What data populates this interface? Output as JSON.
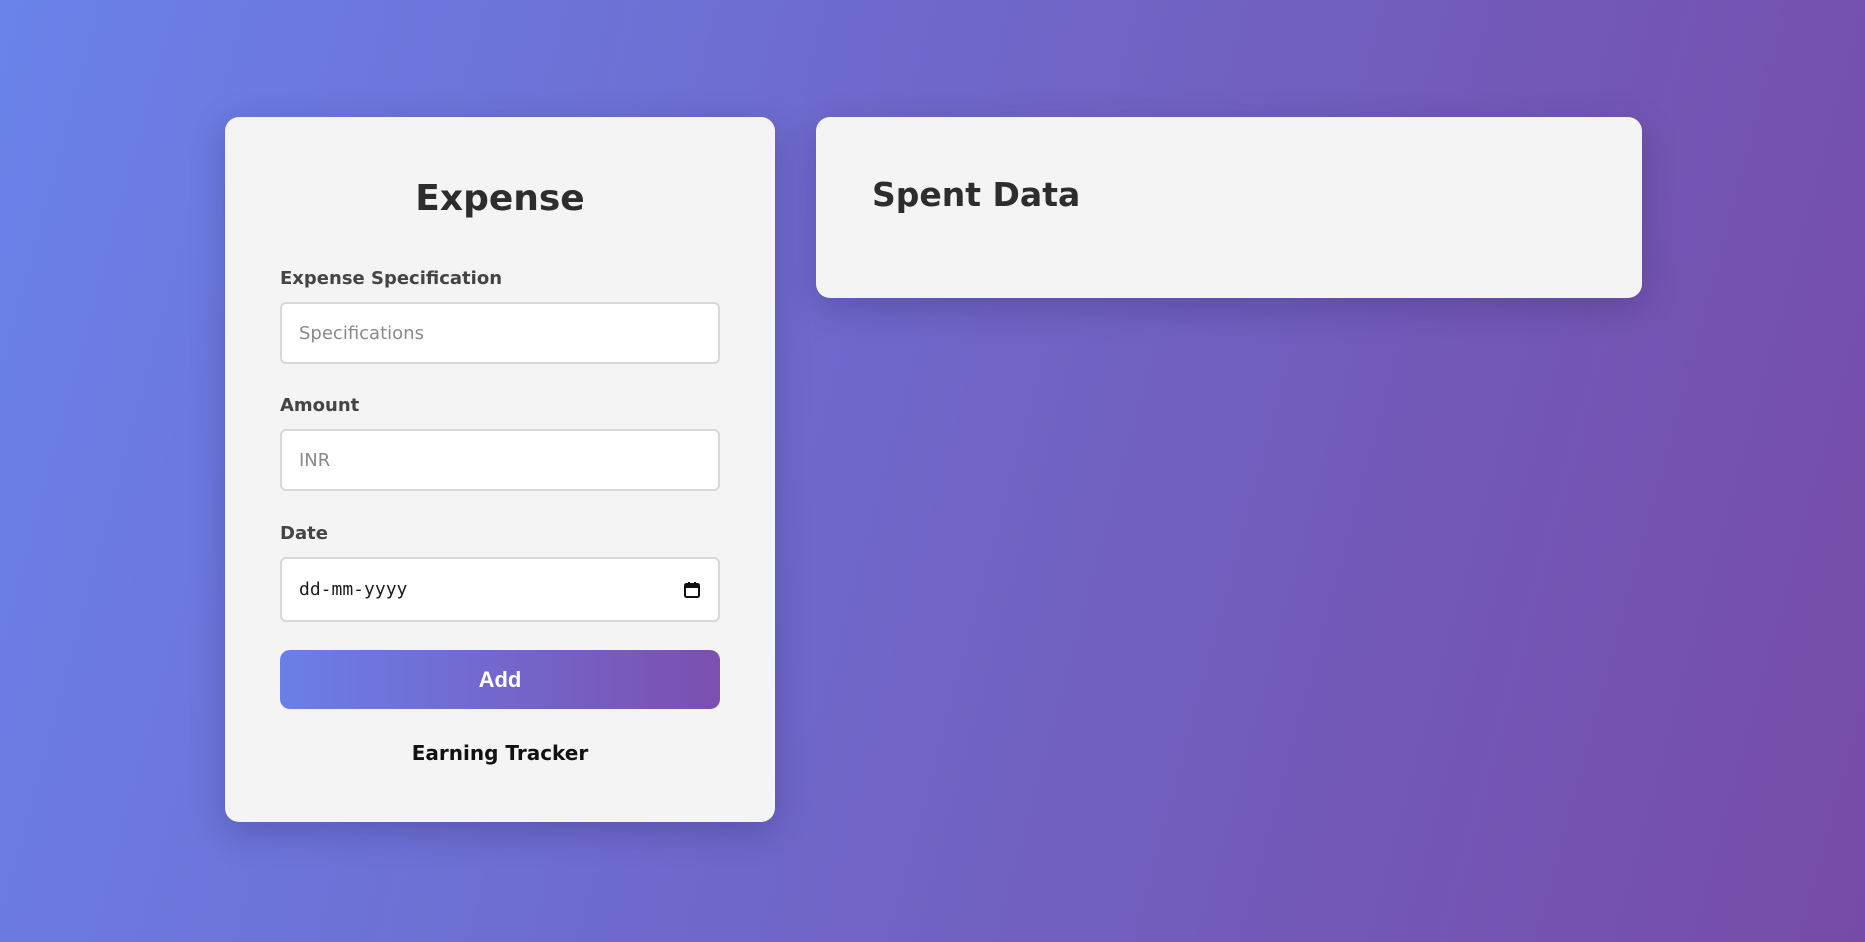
{
  "expense_form": {
    "title": "Expense",
    "specification_label": "Expense Specification",
    "specification_placeholder": "Specifications",
    "amount_label": "Amount",
    "amount_placeholder": "INR",
    "date_label": "Date",
    "date_value": "dd-mm-yyyy",
    "date_icon": "calendar-icon",
    "add_button_label": "Add",
    "earning_link_label": "Earning Tracker"
  },
  "spent_panel": {
    "title": "Spent Data"
  },
  "colors": {
    "background_start": "#6a82ea",
    "background_end": "#764ba6",
    "card_background": "#f4f4f4",
    "button_start": "#6a7fe8",
    "button_end": "#7c4fb0"
  }
}
